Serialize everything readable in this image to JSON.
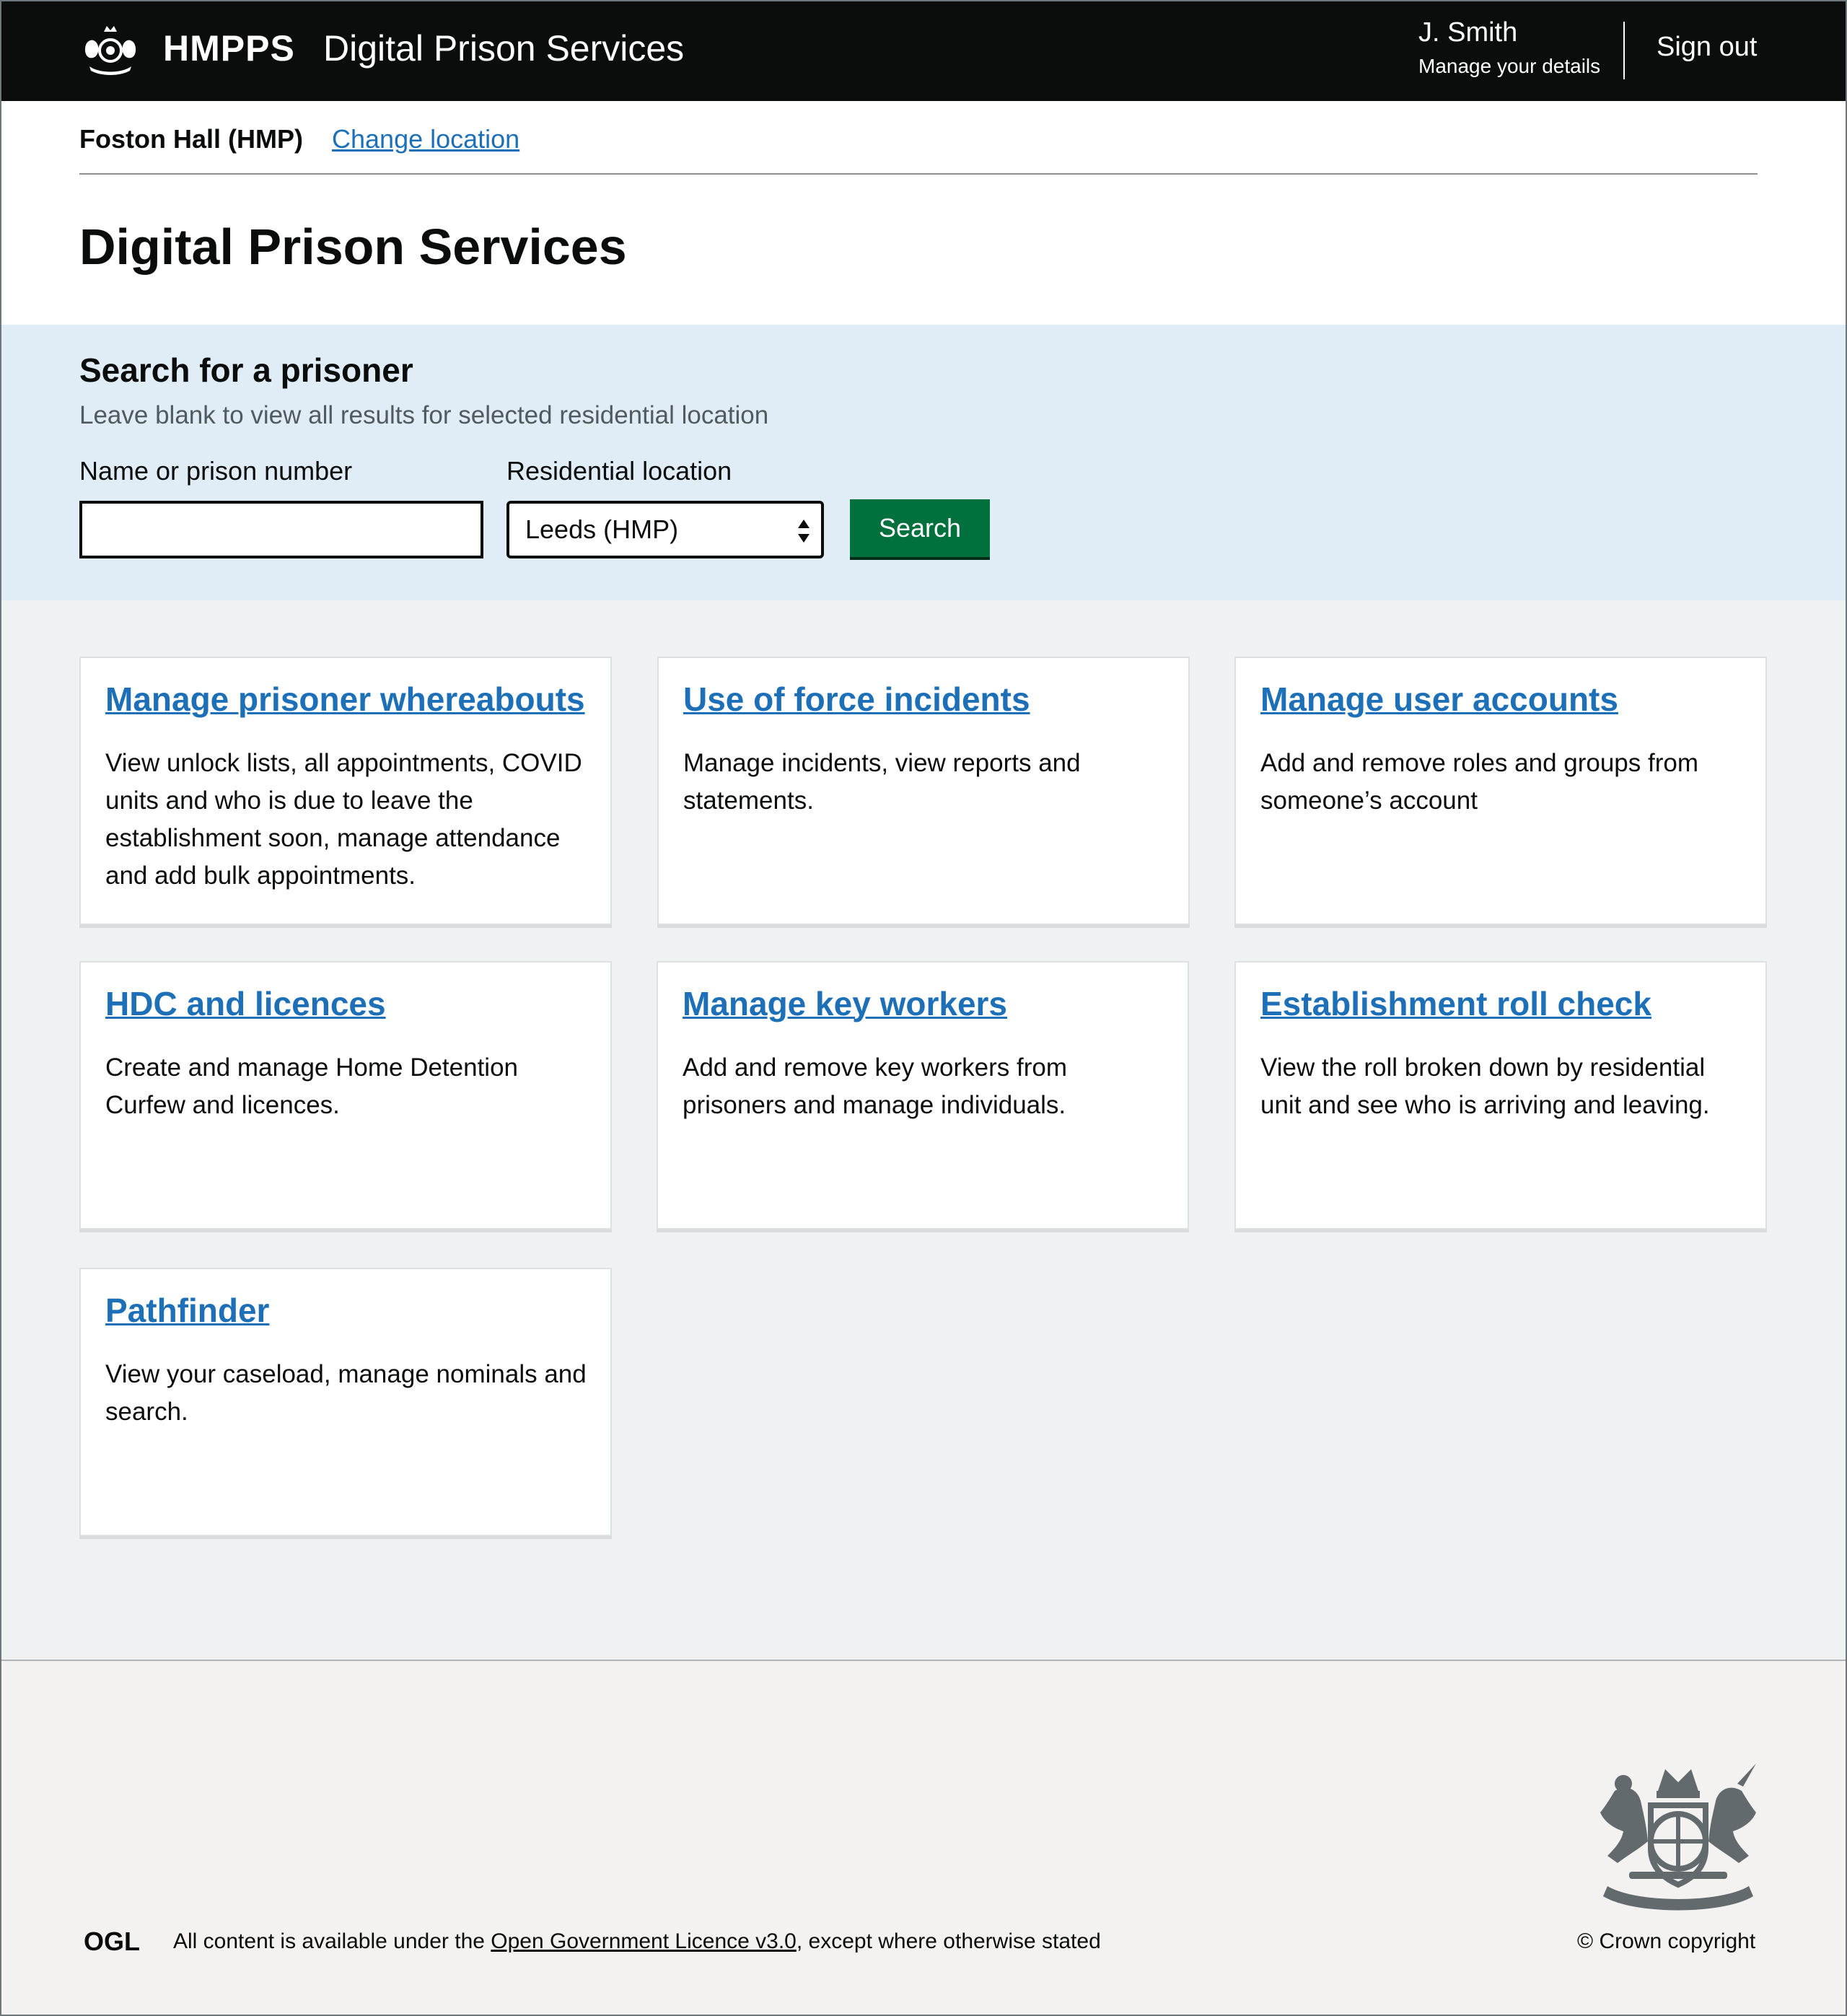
{
  "header": {
    "brand": "HMPPS",
    "service_name": "Digital Prison Services",
    "user_name": "J. Smith",
    "manage_details": "Manage your details",
    "sign_out": "Sign out"
  },
  "location": {
    "name": "Foston Hall (HMP)",
    "change_label": "Change location"
  },
  "page_title": "Digital Prison Services",
  "search": {
    "heading": "Search for a prisoner",
    "hint": "Leave blank to view all results for selected residential location",
    "name_label": "Name or prison number",
    "name_value": "",
    "location_label": "Residential location",
    "location_selected": "Leeds (HMP)",
    "button_label": "Search"
  },
  "tiles": [
    {
      "title": "Manage prisoner whereabouts",
      "description": "View unlock lists, all appointments, COVID units and who is due to leave the establishment soon, manage attendance and add bulk appointments."
    },
    {
      "title": "Use of force incidents",
      "description": "Manage incidents, view reports and statements."
    },
    {
      "title": "Manage user accounts",
      "description": "Add and remove roles and groups from someone’s account"
    },
    {
      "title": "HDC and licences",
      "description": "Create and manage Home Detention Curfew and licences."
    },
    {
      "title": "Manage key workers",
      "description": "Add and remove key workers from prisoners and manage individuals."
    },
    {
      "title": "Establishment roll check",
      "description": "View the roll broken down by residential unit and see who is arriving and leaving."
    },
    {
      "title": "Pathfinder",
      "description": "View your caseload, manage nominals and search."
    }
  ],
  "footer": {
    "ogl": "OGL",
    "licence_prefix": "All content is available under the ",
    "licence_link": "Open Government Licence v3.0",
    "licence_suffix": ", except where otherwise stated",
    "copyright": "© Crown copyright"
  },
  "colors": {
    "header_bg": "#0b0c0c",
    "link": "#1d70b8",
    "search_panel_bg": "#e0ecf6",
    "tiles_bg": "#eef2f3",
    "button_green": "#00703c",
    "footer_bg": "#f3f2f1"
  },
  "icons": {
    "header_logo": "royal-crest-icon",
    "select_arrows": "up-down-arrows-icon",
    "footer_logo": "ogl-logo",
    "footer_crest": "royal-coat-of-arms-icon"
  }
}
